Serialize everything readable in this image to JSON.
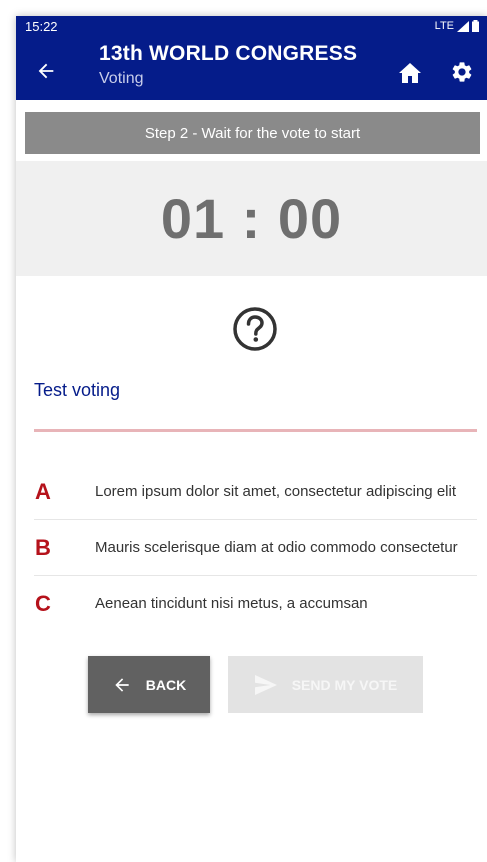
{
  "status_bar": {
    "time": "15:22",
    "network": "LTE"
  },
  "app_bar": {
    "title": "13th WORLD CONGRESS",
    "subtitle": "Voting",
    "icons": [
      "back-arrow-icon",
      "home-icon",
      "gear-icon"
    ]
  },
  "step_banner": "Step 2 - Wait for the vote to start",
  "timer": "01 : 00",
  "question": {
    "icon": "question-circle-icon",
    "title": "Test voting"
  },
  "options": [
    {
      "letter": "A",
      "text": "Lorem ipsum dolor sit amet, consectetur adipiscing elit"
    },
    {
      "letter": "B",
      "text": "Mauris scelerisque diam at odio commodo consectetur"
    },
    {
      "letter": "C",
      "text": "Aenean tincidunt nisi metus, a accumsan"
    }
  ],
  "buttons": {
    "back_label": "BACK",
    "send_label": "SEND MY VOTE"
  },
  "colors": {
    "brand": "#051c8a",
    "option_letter": "#b5121b",
    "divider": "#e8b4b8",
    "banner": "#8a8a8a",
    "back_button": "#616161",
    "send_button_disabled": "#e3e3e3"
  }
}
